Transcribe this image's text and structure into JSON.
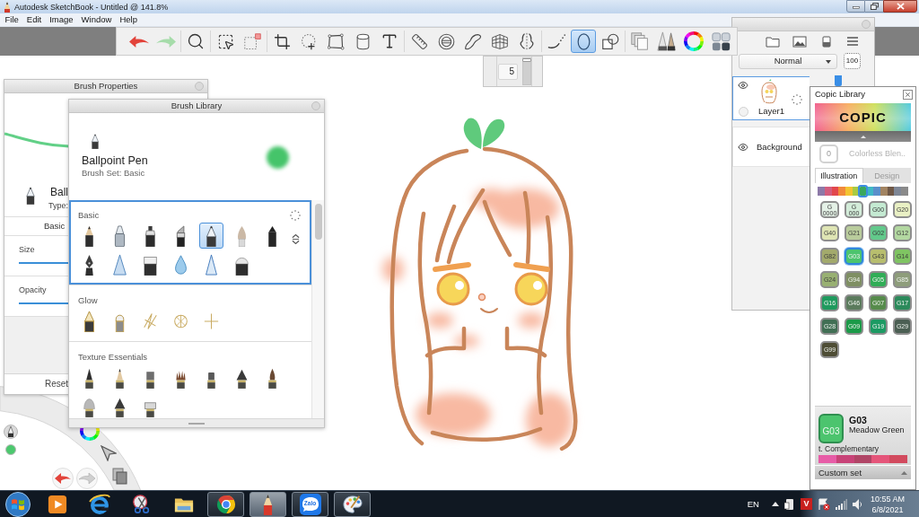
{
  "window": {
    "title": "Autodesk SketchBook - Untitled @ 141.8%"
  },
  "menu": [
    "File",
    "Edit",
    "Image",
    "Window",
    "Help"
  ],
  "toolbar": {
    "groups": [
      [
        {
          "kind": "undo",
          "selected": false
        },
        {
          "kind": "redo",
          "selected": false
        }
      ],
      [
        {
          "kind": "zoom",
          "selected": false
        }
      ],
      [
        {
          "kind": "select",
          "selected": false
        },
        {
          "kind": "select-clear",
          "selected": false
        }
      ],
      [
        {
          "kind": "crop",
          "selected": false
        },
        {
          "kind": "transform",
          "selected": false
        },
        {
          "kind": "distort",
          "selected": false
        },
        {
          "kind": "fill",
          "selected": false
        },
        {
          "kind": "text",
          "selected": false
        }
      ],
      [
        {
          "kind": "ruler",
          "selected": false
        },
        {
          "kind": "ellipse-guide",
          "selected": false
        },
        {
          "kind": "french-curve",
          "selected": false
        },
        {
          "kind": "perspective",
          "selected": false
        },
        {
          "kind": "symmetry",
          "selected": false
        }
      ],
      [
        {
          "kind": "predict",
          "selected": false
        },
        {
          "kind": "ellipse",
          "selected": true
        },
        {
          "kind": "shapes",
          "selected": false
        }
      ],
      [
        {
          "kind": "copy",
          "selected": false
        },
        {
          "kind": "brushes",
          "selected": false
        },
        {
          "kind": "color-wheel",
          "selected": false
        },
        {
          "kind": "palette",
          "selected": false
        }
      ]
    ]
  },
  "brush_size": {
    "value": "5",
    "level": 1
  },
  "brush_properties": {
    "title": "Brush Properties",
    "brush_name": "Ball",
    "type_label": "Type:",
    "tabs": [
      "Basic"
    ],
    "sliders": [
      "Size",
      "Opacity"
    ],
    "reset": "Reset"
  },
  "brush_library": {
    "title": "Brush Library",
    "current": {
      "name": "Ballpoint Pen",
      "set": "Brush Set: Basic"
    },
    "sets": [
      {
        "name": "Basic",
        "selected": true,
        "brushes": [
          {
            "kind": "pencil",
            "selected": false
          },
          {
            "kind": "airbrush",
            "selected": false
          },
          {
            "kind": "marker",
            "selected": false
          },
          {
            "kind": "chisel",
            "selected": false
          },
          {
            "kind": "ballpoint",
            "selected": true
          },
          {
            "kind": "paintbrush",
            "selected": false
          },
          {
            "kind": "inkpen",
            "selected": false
          },
          {
            "kind": "nib",
            "selected": false
          },
          {
            "kind": "cone",
            "selected": false
          },
          {
            "kind": "block",
            "selected": false
          },
          {
            "kind": "drop",
            "selected": false
          },
          {
            "kind": "triangle",
            "selected": false
          },
          {
            "kind": "dome",
            "selected": false
          }
        ]
      },
      {
        "name": "Glow",
        "selected": false,
        "brushes": [
          {
            "kind": "glow-pen",
            "selected": false
          },
          {
            "kind": "glow-marker",
            "selected": false
          },
          {
            "kind": "scribble",
            "selected": false
          },
          {
            "kind": "burst",
            "selected": false
          },
          {
            "kind": "sparkle",
            "selected": false
          }
        ]
      },
      {
        "name": "Texture Essentials",
        "selected": false,
        "brushes": [
          {
            "kind": "tex-pen",
            "selected": false
          },
          {
            "kind": "tex-pencil",
            "selected": false
          },
          {
            "kind": "tex-block",
            "selected": false
          },
          {
            "kind": "tex-bristle",
            "selected": false
          },
          {
            "kind": "tex-stub",
            "selected": false
          },
          {
            "kind": "tex-cone",
            "selected": false
          },
          {
            "kind": "tex-brush",
            "selected": false
          },
          {
            "kind": "tex-dome",
            "selected": false
          },
          {
            "kind": "tex-cone",
            "selected": false
          },
          {
            "kind": "tex-wide",
            "selected": false
          }
        ]
      }
    ]
  },
  "layers": {
    "blend_mode": "Normal",
    "opacity": "100",
    "items": [
      {
        "name": "Layer1",
        "kind": "paint",
        "selected": true,
        "visible": true
      },
      {
        "name": "Background",
        "kind": "background",
        "selected": false,
        "visible": true
      }
    ]
  },
  "copic": {
    "title": "Copic Library",
    "logo": "COPIC",
    "colorless": {
      "code": "0",
      "name": "Colorless Blen.."
    },
    "tabs": [
      {
        "label": "Illustration",
        "selected": true
      },
      {
        "label": "Design",
        "selected": false
      }
    ],
    "families": [
      {
        "color": "#8d79a8",
        "selected": false
      },
      {
        "color": "#d35d7e",
        "selected": false
      },
      {
        "color": "#e2474c",
        "selected": false
      },
      {
        "color": "#f18a3b",
        "selected": false
      },
      {
        "color": "#f3c431",
        "selected": false
      },
      {
        "color": "#a9cb44",
        "selected": false
      },
      {
        "color": "#3aa85e",
        "selected": true
      },
      {
        "color": "#3fb8c6",
        "selected": false
      },
      {
        "color": "#5a8fcb",
        "selected": false
      },
      {
        "color": "#a28462",
        "selected": false
      },
      {
        "color": "#6f5847",
        "selected": false
      },
      {
        "color": "#7f8796",
        "selected": false
      },
      {
        "color": "#8a8a8a",
        "selected": false
      }
    ],
    "swatches": [
      {
        "code": "G 0000",
        "color": "#e4f1e6",
        "selected": false
      },
      {
        "code": "G 000",
        "color": "#d3ecd9",
        "selected": false
      },
      {
        "code": "G00",
        "color": "#c4ead2",
        "selected": false
      },
      {
        "code": "G20",
        "color": "#e9f0c4",
        "selected": false
      },
      {
        "code": "G40",
        "color": "#dfe5b4",
        "selected": false
      },
      {
        "code": "G21",
        "color": "#b9cc9c",
        "selected": false
      },
      {
        "code": "G02",
        "color": "#62c98b",
        "selected": false
      },
      {
        "code": "G12",
        "color": "#b3d8a1",
        "selected": false
      },
      {
        "code": "G82",
        "color": "#a3aa6c",
        "selected": false
      },
      {
        "code": "G03",
        "color": "#4cc46e",
        "selected": true
      },
      {
        "code": "G43",
        "color": "#b8be6e",
        "selected": false
      },
      {
        "code": "G14",
        "color": "#7fc462",
        "selected": false
      },
      {
        "code": "G24",
        "color": "#98b072",
        "selected": false
      },
      {
        "code": "G94",
        "color": "#7f8f63",
        "selected": false
      },
      {
        "code": "G05",
        "color": "#31ad57",
        "selected": false
      },
      {
        "code": "G85",
        "color": "#8e9d7b",
        "selected": false
      },
      {
        "code": "G16",
        "color": "#1f9a5e",
        "selected": false
      },
      {
        "code": "G46",
        "color": "#5b7b5d",
        "selected": false
      },
      {
        "code": "G07",
        "color": "#568b4b",
        "selected": false
      },
      {
        "code": "G17",
        "color": "#2c8a5b",
        "selected": false
      },
      {
        "code": "G28",
        "color": "#416f54",
        "selected": false
      },
      {
        "code": "G09",
        "color": "#1b9a48",
        "selected": false
      },
      {
        "code": "G19",
        "color": "#1c9a63",
        "selected": false
      },
      {
        "code": "G29",
        "color": "#4b5f53",
        "selected": false
      },
      {
        "code": "G99",
        "color": "#4e4d35",
        "selected": false
      }
    ],
    "current": {
      "swatch_label": "G03",
      "code": "G03",
      "name": "Meadow Green"
    },
    "complementary": {
      "label": "t. Complementary",
      "colors": [
        {
          "color": "#e75ca7"
        },
        {
          "color": "#c84378"
        },
        {
          "color": "#b04566"
        },
        {
          "color": "#e5557a"
        },
        {
          "color": "#d24a5e"
        }
      ]
    },
    "custom_set": "Custom set"
  },
  "taskbar": {
    "apps": [
      {
        "kind": "media",
        "running": false,
        "active": false
      },
      {
        "kind": "browser",
        "running": false,
        "active": false
      },
      {
        "kind": "snipping",
        "running": false,
        "active": false
      },
      {
        "kind": "explorer",
        "running": false,
        "active": false
      },
      {
        "kind": "round-browser",
        "running": true,
        "active": false
      },
      {
        "kind": "sketch",
        "running": true,
        "active": true
      },
      {
        "kind": "chat",
        "label": "Zalo",
        "running": true,
        "active": false
      },
      {
        "kind": "paint",
        "running": true,
        "active": false
      }
    ],
    "tray": {
      "language": "EN",
      "icons": [
        {
          "kind": "caret"
        },
        {
          "kind": "device"
        },
        {
          "kind": "badge",
          "label": "V"
        },
        {
          "kind": "flag"
        },
        {
          "kind": "signal"
        },
        {
          "kind": "speaker"
        }
      ],
      "time": "10:55 AM",
      "date": "6/8/2021"
    }
  }
}
